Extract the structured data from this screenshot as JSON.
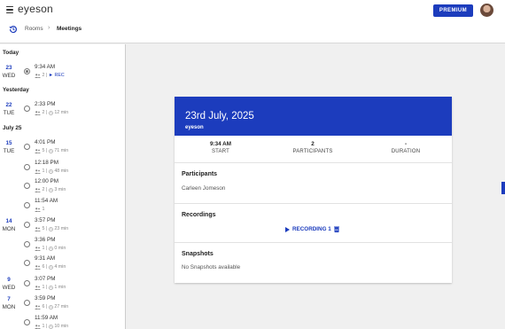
{
  "app": {
    "logo_text": "eyeson",
    "premium_label": "PREMIUM"
  },
  "breadcrumb": {
    "rooms": "Rooms",
    "separator": "›",
    "current": "Meetings"
  },
  "colors": {
    "accent": "#1c3cbd",
    "muted": "#888888"
  },
  "sidebar": {
    "sections": [
      {
        "label": "Today"
      },
      {
        "label": "Yesterday"
      },
      {
        "label": "July 25"
      }
    ],
    "days": [
      {
        "num": "23",
        "name": "WED"
      },
      {
        "num": "22",
        "name": "TUE"
      },
      {
        "num": "15",
        "name": "TUE"
      },
      {
        "num": "14",
        "name": "MON"
      },
      {
        "num": "9",
        "name": "WED"
      },
      {
        "num": "7",
        "name": "MON"
      }
    ],
    "meetings": [
      {
        "time": "9:34 AM",
        "participants": "2",
        "sep": "|",
        "extra": "► REC",
        "selected": true
      },
      {
        "time": "2:33 PM",
        "participants": "2",
        "sep": "|",
        "extra": "12 min"
      },
      {
        "time": "4:01 PM",
        "participants": "5",
        "sep": "|",
        "extra": "71 min"
      },
      {
        "time": "12:18 PM",
        "participants": "1",
        "sep": "|",
        "extra": "48 min"
      },
      {
        "time": "12:00 PM",
        "participants": "2",
        "sep": "|",
        "extra": "3 min"
      },
      {
        "time": "11:54 AM",
        "participants": "1",
        "sep": "",
        "extra": ""
      },
      {
        "time": "3:57 PM",
        "participants": "5",
        "sep": "|",
        "extra": "23 min"
      },
      {
        "time": "3:36 PM",
        "participants": "1",
        "sep": "|",
        "extra": "0 min"
      },
      {
        "time": "9:31 AM",
        "participants": "6",
        "sep": "|",
        "extra": "4 min"
      },
      {
        "time": "3:07 PM",
        "participants": "1",
        "sep": "|",
        "extra": "1 min"
      },
      {
        "time": "3:59 PM",
        "participants": "6",
        "sep": "|",
        "extra": "27 min"
      },
      {
        "time": "11:59 AM",
        "participants": "1",
        "sep": "|",
        "extra": "10 min"
      }
    ]
  },
  "detail": {
    "date": "23rd July, 2025",
    "brand": "eyeson",
    "stats": [
      {
        "value": "9:34 AM",
        "label": "START"
      },
      {
        "value": "2",
        "label": "PARTICIPANTS"
      },
      {
        "value": "-",
        "label": "DURATION"
      }
    ],
    "participants_title": "Participants",
    "participants": [
      "Carleen Jomeson"
    ],
    "recordings_title": "Recordings",
    "recording_label": "RECORDING 1",
    "snapshots_title": "Snapshots",
    "snapshots_empty": "No Snapshots available"
  }
}
